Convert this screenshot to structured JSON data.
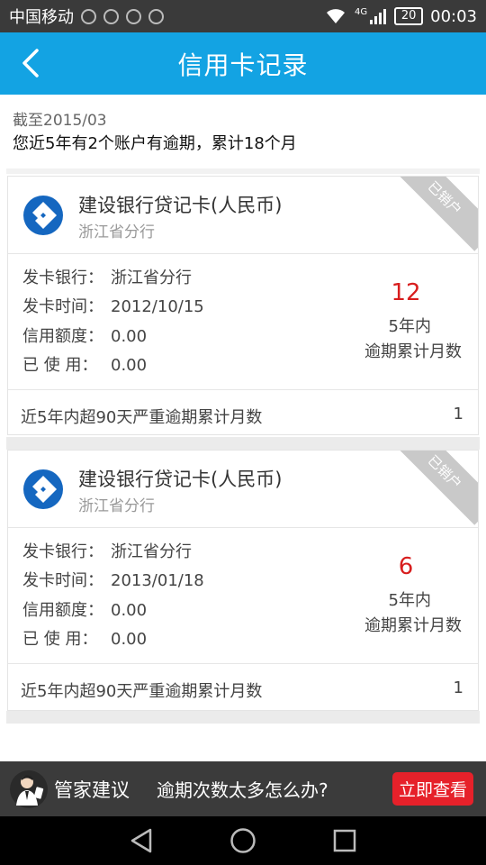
{
  "status": {
    "carrier": "中国移动",
    "network": "4G",
    "battery": "20",
    "time": "00:03"
  },
  "header": {
    "title": "信用卡记录"
  },
  "summary": {
    "date": "截至2015/03",
    "text": "您近5年有2个账户有逾期，累计18个月"
  },
  "labels": {
    "issuer": "发卡银行：",
    "issue_time": "发卡时间：",
    "limit": "信用额度：",
    "used": "已 使 用：",
    "overdue_caption_1": "5年内",
    "overdue_caption_2": "逾期累计月数",
    "severe_overdue": "近5年内超90天严重逾期累计月数",
    "status_badge": "已销户"
  },
  "cards": [
    {
      "bank_name": "建设银行贷记卡(人民币)",
      "branch": "浙江省分行",
      "issuer": "浙江省分行",
      "issue_time": "2012/10/15",
      "limit": "0.00",
      "used": "0.00",
      "overdue_months": "12",
      "severe_overdue_months": "1"
    },
    {
      "bank_name": "建设银行贷记卡(人民币)",
      "branch": "浙江省分行",
      "issuer": "浙江省分行",
      "issue_time": "2013/01/18",
      "limit": "0.00",
      "used": "0.00",
      "overdue_months": "6",
      "severe_overdue_months": "1"
    }
  ],
  "advice": {
    "label": "管家建议",
    "question": "逾期次数太多怎么办?",
    "button": "立即查看"
  },
  "colors": {
    "header_bg": "#13a3e3",
    "overdue_red": "#d81e1e",
    "button_red": "#e6212a",
    "ccb_blue": "#1567c0"
  },
  "icons": {
    "back": "chevron-left-icon",
    "bank_logo": "ccb-logo-icon",
    "nav_back": "triangle-back-icon",
    "nav_home": "circle-home-icon",
    "nav_recent": "square-recent-icon"
  }
}
